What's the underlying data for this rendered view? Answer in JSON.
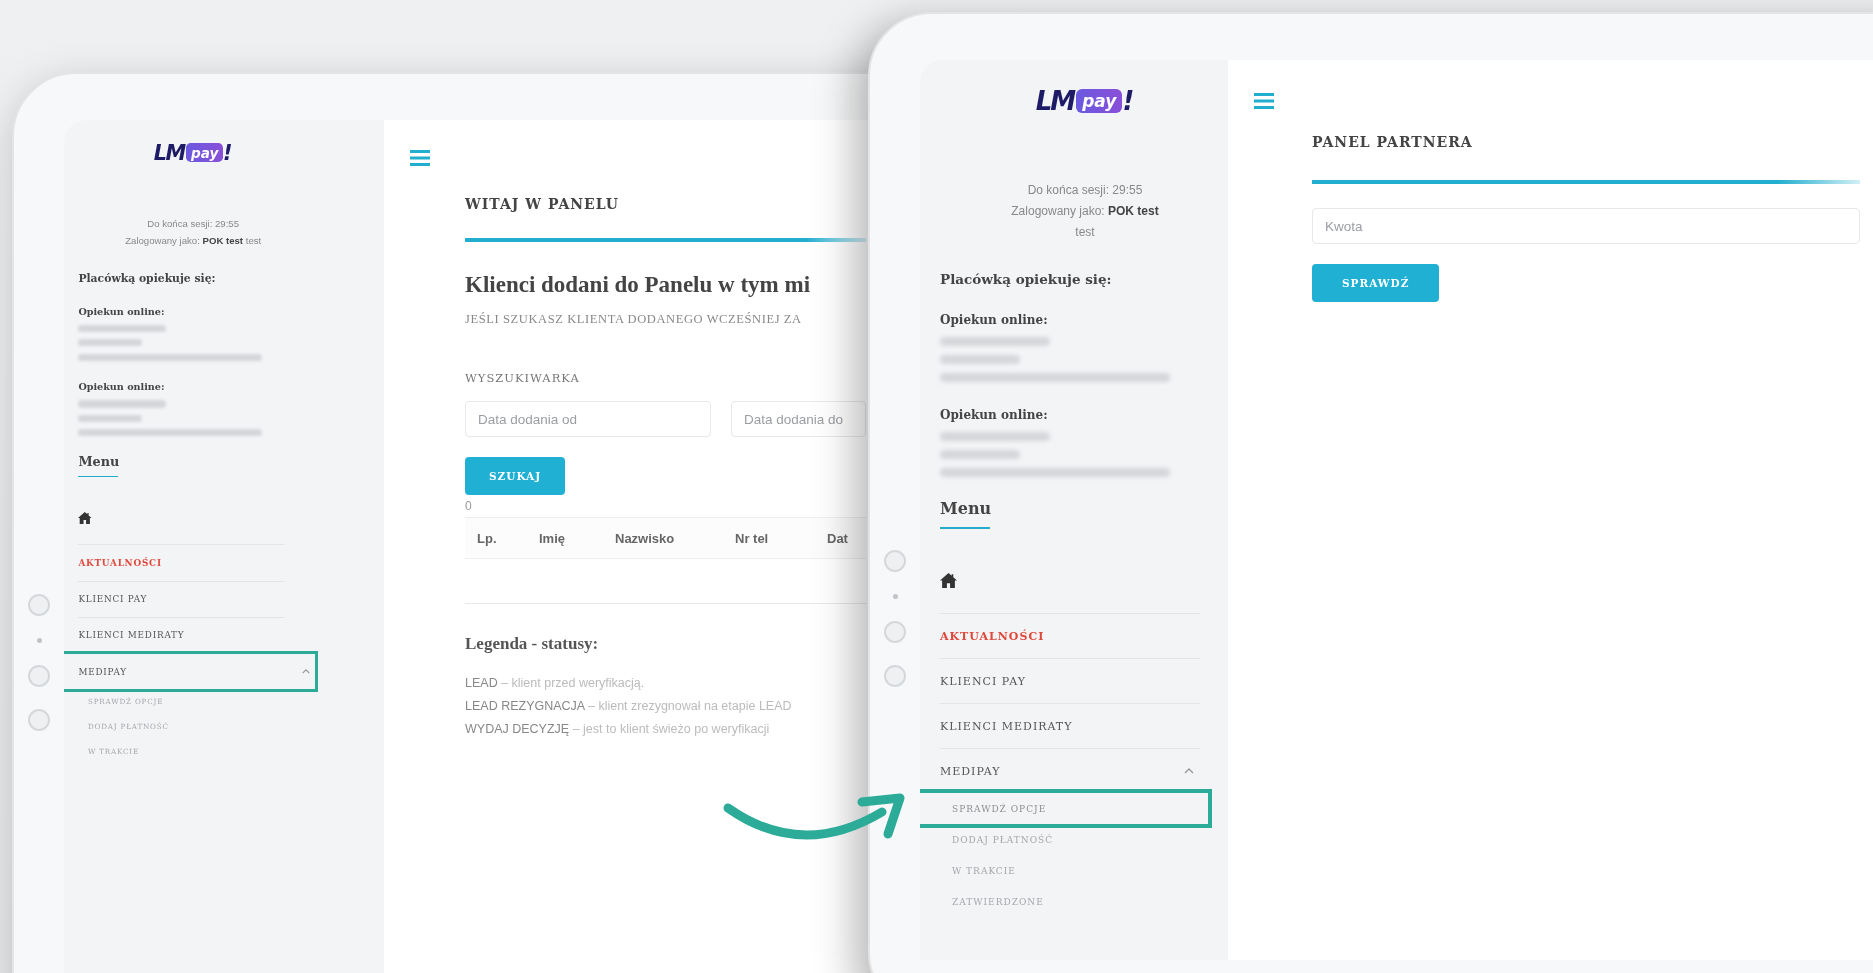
{
  "tablets": [
    {
      "sidebar": {
        "logo": {
          "brand": "LM",
          "badge": "pay",
          "suffix": "!"
        },
        "session": [
          "Do końca sesji: 29:55",
          "Zalogowany jako: **POK test** test"
        ],
        "caretakers_title": "Placówką opiekuje się:",
        "caretakers": [
          {
            "label": "Opiekun online:"
          },
          {
            "label": "Opiekun online:"
          }
        ],
        "menu_title": "Menu",
        "menu": [
          {
            "kind": "home",
            "selected": false,
            "highlighted": false
          },
          {
            "kind": "link",
            "label": "AKTUALNOŚCI",
            "selected": true,
            "highlighted": false
          },
          {
            "kind": "link",
            "label": "KLIENCI PAY",
            "selected": false,
            "highlighted": false
          },
          {
            "kind": "link",
            "label": "KLIENCI MEDIRATY",
            "selected": false,
            "highlighted": false
          },
          {
            "kind": "group",
            "label": "MEDIPAY",
            "selected": false,
            "highlighted": true,
            "expanded": true,
            "children": [
              {
                "label": "SPRAWDŹ OPCJE",
                "selected": false,
                "highlighted": false
              },
              {
                "label": "DODAJ PŁATNOŚĆ",
                "selected": false,
                "highlighted": false
              },
              {
                "label": "W TRAKCIE",
                "selected": false,
                "highlighted": false
              }
            ]
          }
        ]
      },
      "main": {
        "kind": "dashboard",
        "title": "WITAJ W PANELU",
        "heading": "Klienci dodani do Panelu w tym mi",
        "subtitle": "JEŚLI SZUKASZ KLIENTA DODANEGO WCZEŚNIEJ ZA",
        "search_title": "WYSZUKIWARKA",
        "fields": [
          {
            "placeholder": "Data dodania od"
          },
          {
            "placeholder": "Data dodania do"
          }
        ],
        "button": "SZUKAJ",
        "count": "0",
        "columns": [
          "Lp.",
          "Imię",
          "Nazwisko",
          "Nr tel",
          "Dat"
        ],
        "legend_title": "Legenda - statusy:",
        "legend": [
          "**LEAD** – klient przed weryfikacją.",
          "**LEAD REZYGNACJA** – klient zrezygnował na etapie LEAD",
          "**WYDAJ DECYZJĘ** – jest to klient świeżo po weryfikacji"
        ]
      }
    },
    {
      "sidebar": {
        "logo": {
          "brand": "LM",
          "badge": "pay",
          "suffix": "!"
        },
        "session": [
          "Do końca sesji: 29:55",
          "Zalogowany jako: **POK test** test"
        ],
        "caretakers_title": "Placówką opiekuje się:",
        "caretakers": [
          {
            "label": "Opiekun online:"
          },
          {
            "label": "Opiekun online:"
          }
        ],
        "menu_title": "Menu",
        "menu": [
          {
            "kind": "home",
            "selected": false,
            "highlighted": false
          },
          {
            "kind": "link",
            "label": "AKTUALNOŚCI",
            "selected": true,
            "highlighted": false
          },
          {
            "kind": "link",
            "label": "KLIENCI PAY",
            "selected": false,
            "highlighted": false
          },
          {
            "kind": "link",
            "label": "KLIENCI MEDIRATY",
            "selected": false,
            "highlighted": false
          },
          {
            "kind": "group",
            "label": "MEDIPAY",
            "selected": false,
            "highlighted": false,
            "expanded": true,
            "children": [
              {
                "label": "SPRAWDŹ OPCJE",
                "selected": false,
                "highlighted": true
              },
              {
                "label": "DODAJ PŁATNOŚĆ",
                "selected": false,
                "highlighted": false
              },
              {
                "label": "W TRAKCIE",
                "selected": false,
                "highlighted": false
              },
              {
                "label": "ZATWIERDZONE",
                "selected": false,
                "highlighted": false
              }
            ]
          }
        ]
      },
      "main": {
        "kind": "partner_panel",
        "title": "PANEL PARTNERA",
        "field": {
          "placeholder": "Kwota"
        },
        "button": "SPRAWDŹ"
      }
    }
  ]
}
